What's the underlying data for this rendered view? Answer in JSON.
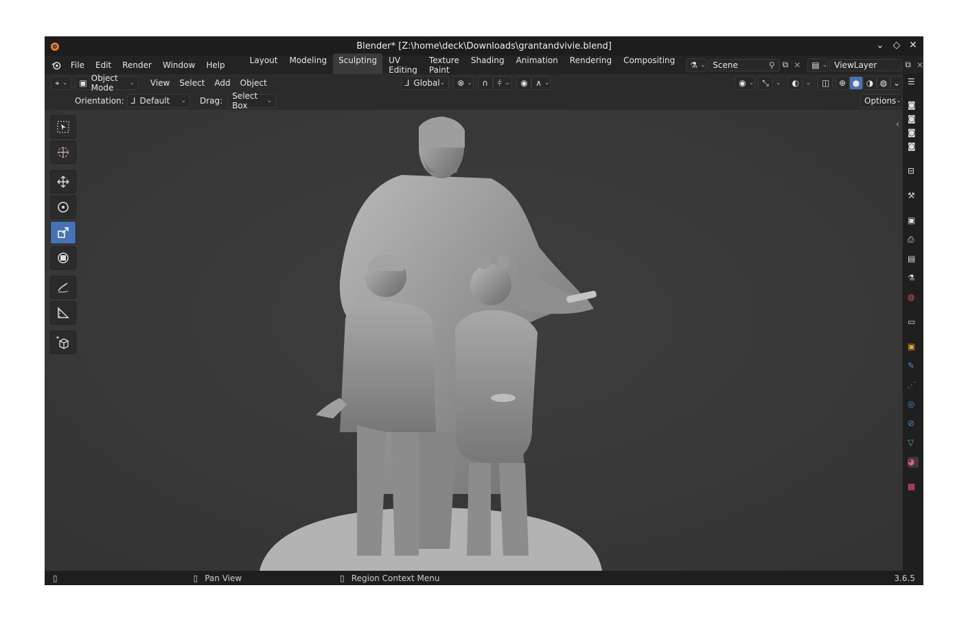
{
  "window": {
    "title": "Blender* [Z:\\home\\deck\\Downloads\\grantandvivie.blend]"
  },
  "menu": {
    "items": [
      "File",
      "Edit",
      "Render",
      "Window",
      "Help"
    ]
  },
  "workspaces": {
    "tabs": [
      "Layout",
      "Modeling",
      "Sculpting",
      "UV Editing",
      "Texture Paint",
      "Shading",
      "Animation",
      "Rendering",
      "Compositing"
    ],
    "active": "Sculpting"
  },
  "scene": {
    "label": "Scene"
  },
  "viewlayer": {
    "label": "ViewLayer"
  },
  "header": {
    "mode": "Object Mode",
    "menus": [
      "View",
      "Select",
      "Add",
      "Object"
    ],
    "transform_orientation": "Global"
  },
  "tool_header": {
    "orientation_label": "Orientation:",
    "orientation_value": "Default",
    "drag_label": "Drag:",
    "drag_value": "Select Box",
    "options_label": "Options"
  },
  "status": {
    "pan": "Pan View",
    "context": "Region Context Menu",
    "version": "3.6.5"
  },
  "colors": {
    "accent": "#4772b3",
    "viewport_bg": "#3a3a3a",
    "panel_bg": "#2b2b2b",
    "titlebar_bg": "#1d1d1d"
  }
}
